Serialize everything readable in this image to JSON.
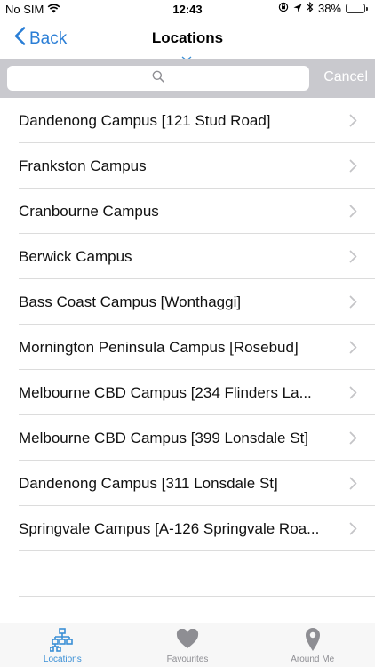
{
  "status_bar": {
    "carrier": "No SIM",
    "time": "12:43",
    "battery_percent": "38%",
    "battery_level": 0.38,
    "battery_color": "#f5c400"
  },
  "nav": {
    "back_label": "Back",
    "title": "Locations"
  },
  "search": {
    "placeholder": "",
    "value": "",
    "cancel_label": "Cancel"
  },
  "locations": [
    {
      "label": "Dandenong Campus [121 Stud Road]"
    },
    {
      "label": "Frankston Campus"
    },
    {
      "label": "Cranbourne Campus"
    },
    {
      "label": "Berwick Campus"
    },
    {
      "label": "Bass Coast Campus [Wonthaggi]"
    },
    {
      "label": "Mornington Peninsula Campus [Rosebud]"
    },
    {
      "label": "Melbourne CBD Campus [234 Flinders La..."
    },
    {
      "label": "Melbourne CBD Campus [399 Lonsdale St]"
    },
    {
      "label": "Dandenong Campus [311 Lonsdale St]"
    },
    {
      "label": "Springvale Campus [A-126 Springvale Roa..."
    }
  ],
  "tabs": [
    {
      "label": "Locations",
      "icon": "sitemap-icon",
      "active": true
    },
    {
      "label": "Favourites",
      "icon": "heart-icon",
      "active": false
    },
    {
      "label": "Around Me",
      "icon": "map-pin-icon",
      "active": false
    }
  ],
  "colors": {
    "accent": "#2a7ed6",
    "tab_active": "#3a8fd6",
    "tab_inactive": "#8e8e93",
    "search_bar_bg": "#c9c9ce"
  }
}
